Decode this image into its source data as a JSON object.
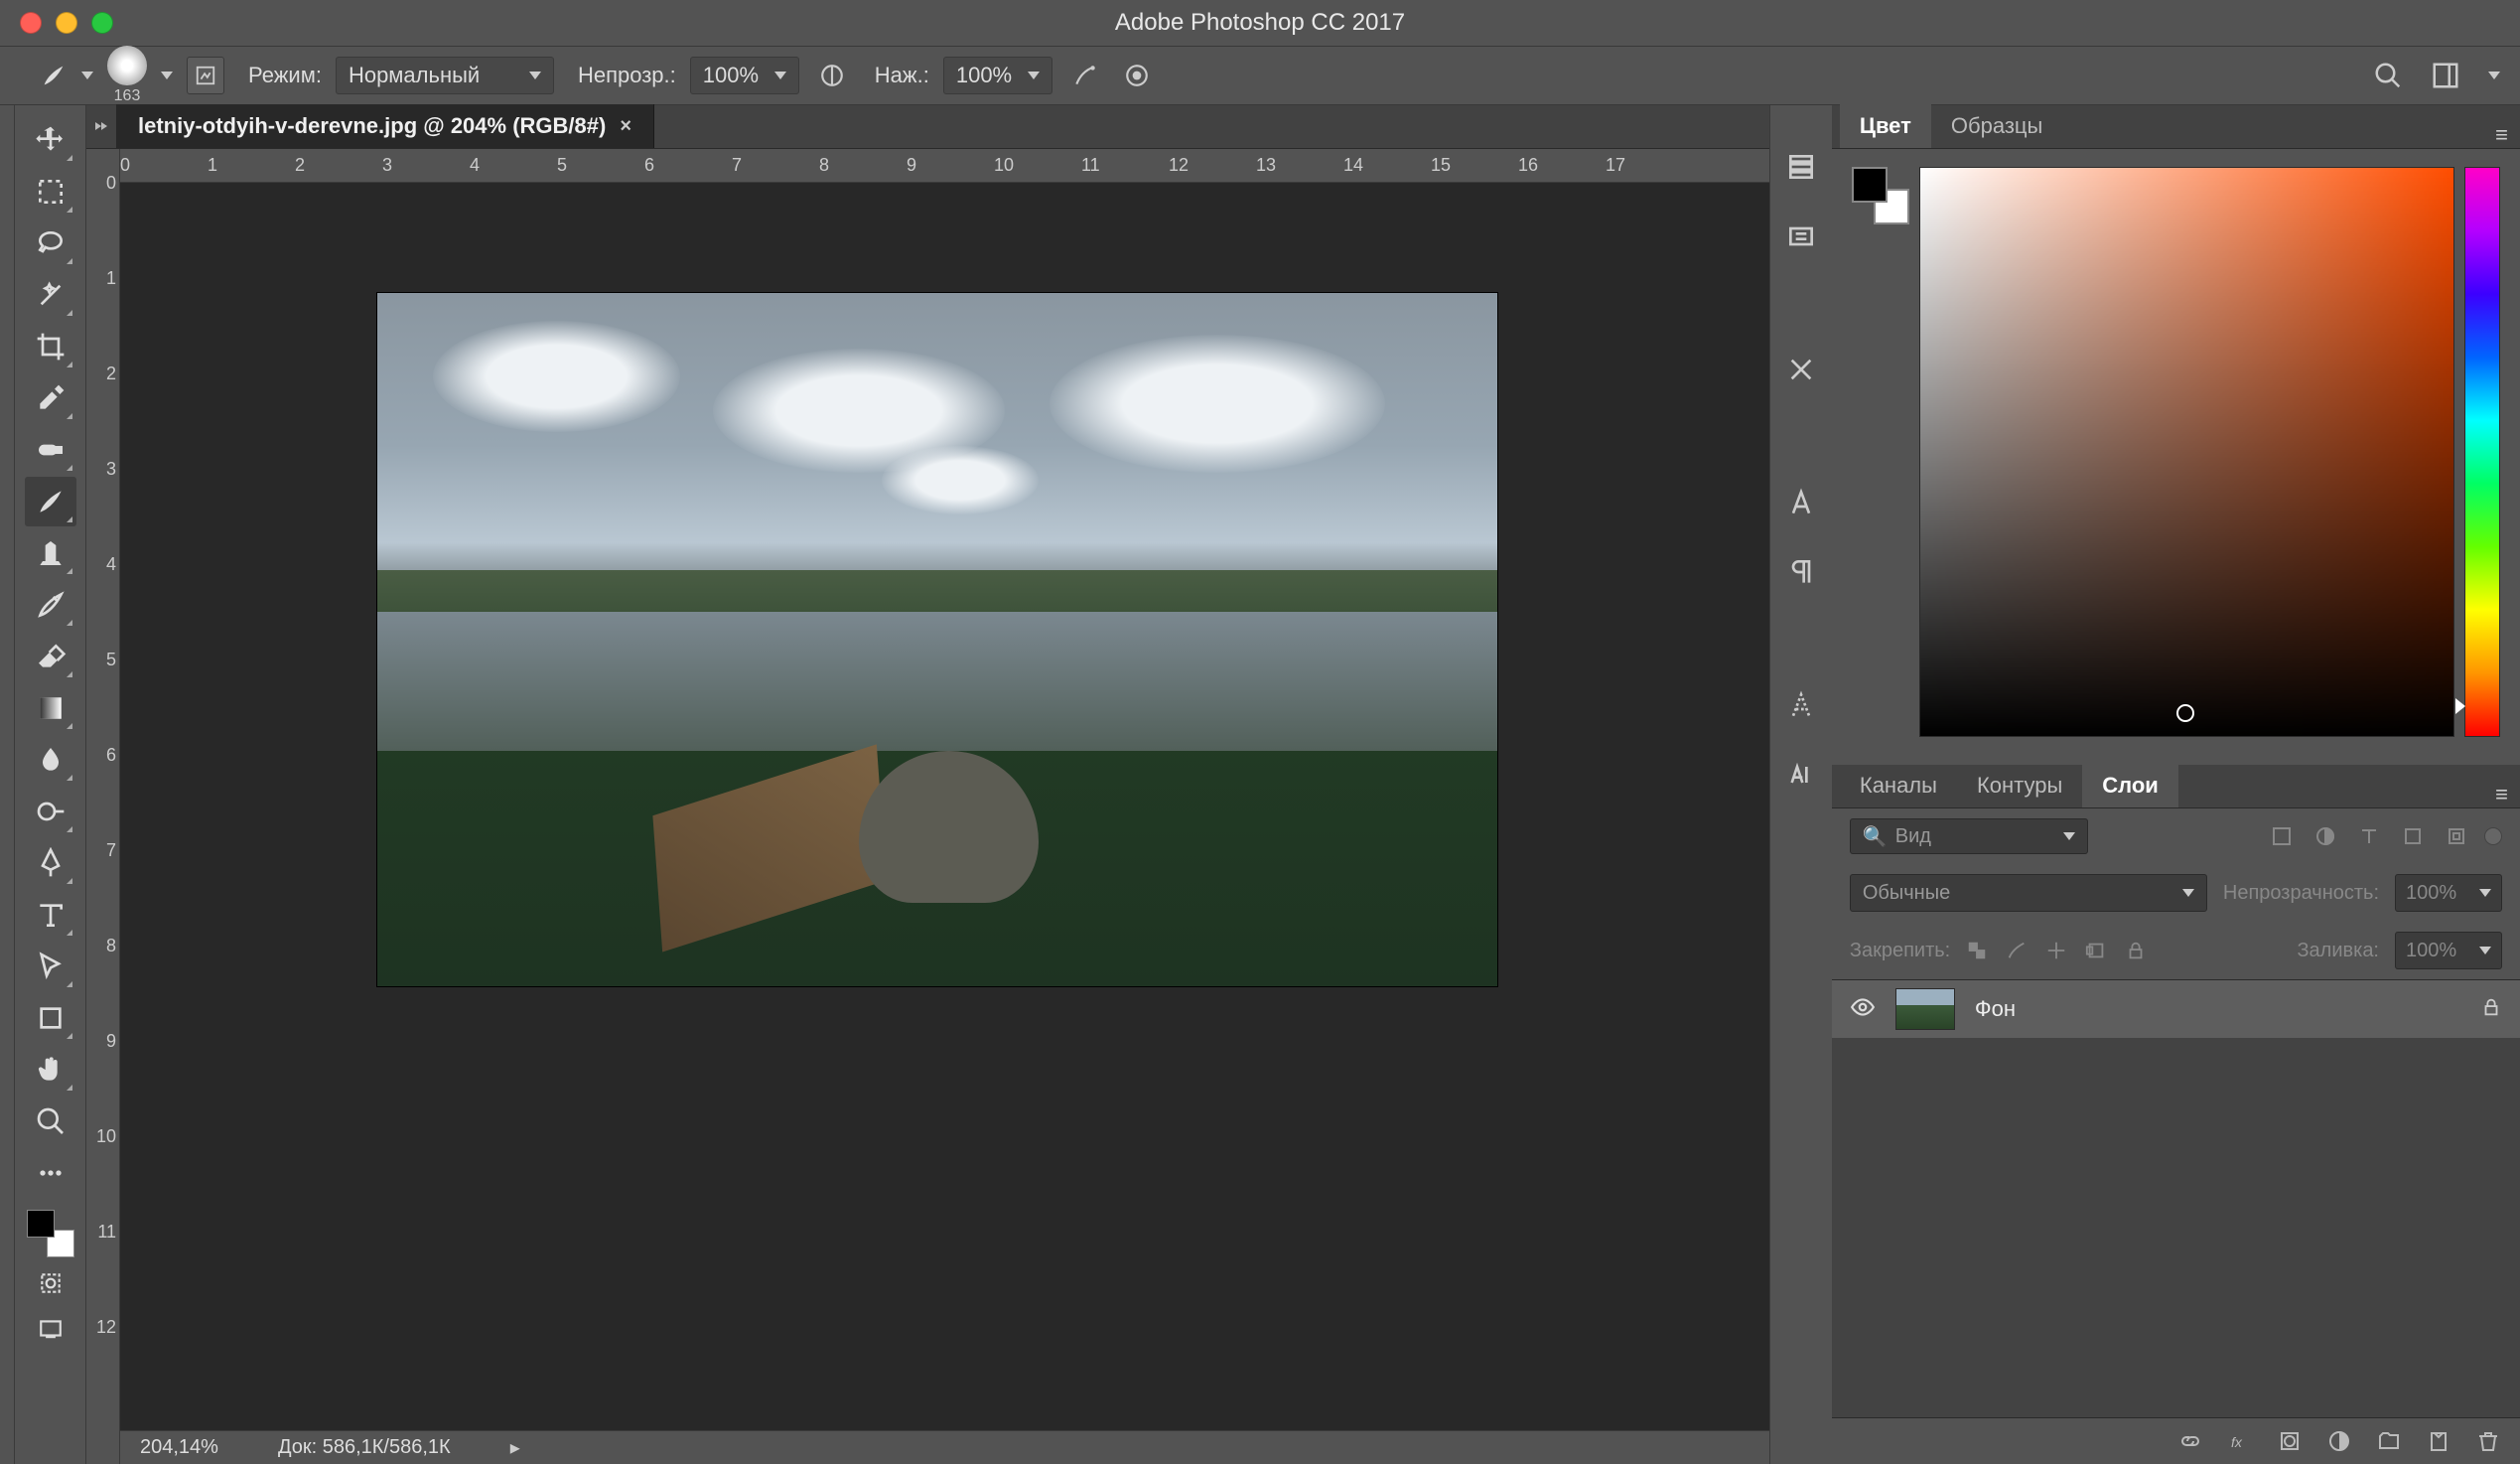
{
  "app_title": "Adobe Photoshop CC 2017",
  "options_bar": {
    "brush_size": "163",
    "mode_label": "Режим:",
    "mode_value": "Нормальный",
    "opacity_label": "Непрозр.:",
    "opacity_value": "100%",
    "flow_label": "Наж.:",
    "flow_value": "100%"
  },
  "document_tab": "letniy-otdyih-v-derevne.jpg @ 204% (RGB/8#)",
  "ruler_h": [
    "0",
    "1",
    "2",
    "3",
    "4",
    "5",
    "6",
    "7",
    "8",
    "9",
    "10",
    "11",
    "12",
    "13",
    "14",
    "15",
    "16",
    "17"
  ],
  "ruler_v": [
    "0",
    "1",
    "2",
    "3",
    "4",
    "5",
    "6",
    "7",
    "8",
    "9",
    "10",
    "11",
    "12"
  ],
  "status": {
    "zoom": "204,14%",
    "doc": "Док: 586,1К/586,1К"
  },
  "color_panel": {
    "tab_color": "Цвет",
    "tab_swatches": "Образцы"
  },
  "layers_panel": {
    "tab_channels": "Каналы",
    "tab_paths": "Контуры",
    "tab_layers": "Слои",
    "kind_label": "Вид",
    "blend_label": "Обычные",
    "opacity_label": "Непрозрачность:",
    "opacity_value": "100%",
    "lock_label": "Закрепить:",
    "fill_label": "Заливка:",
    "fill_value": "100%",
    "layer_name": "Фон"
  }
}
